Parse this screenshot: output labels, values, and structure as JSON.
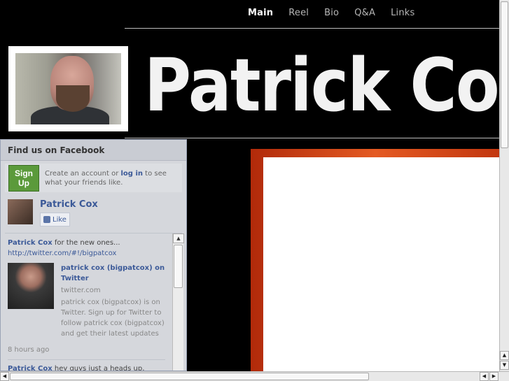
{
  "nav": {
    "items": [
      {
        "label": "Main"
      },
      {
        "label": "Reel"
      },
      {
        "label": "Bio"
      },
      {
        "label": "Q&A"
      },
      {
        "label": "Links"
      }
    ]
  },
  "banner": {
    "title": "Patrick Cox"
  },
  "facebook": {
    "header": "Find us on Facebook",
    "signup_button": "Sign Up",
    "signup_text_pre": "Create an account or ",
    "signup_link": "log in",
    "signup_text_post": " to see what your friends like.",
    "page_name": "Patrick Cox",
    "like_label": "Like",
    "posts": [
      {
        "author": "Patrick Cox",
        "text": " for the new ones...",
        "url": "http://twitter.com/#!/bigpatcox",
        "card_title": "patrick cox (bigpatcox) on Twitter",
        "card_domain": "twitter.com",
        "card_desc": "patrick cox (bigpatcox) is on Twitter. Sign up for Twitter to follow patrick cox (bigpatcox) and get their latest updates",
        "time": "8 hours ago"
      },
      {
        "author": "Patrick Cox",
        "text": " hey guys just a heads up, heading to"
      }
    ]
  },
  "icons": {
    "up_arrow": "▲",
    "down_arrow": "▼",
    "left_arrow": "◀",
    "right_arrow": "▶"
  },
  "colors": {
    "background": "#000000",
    "facebook_link": "#3b5998",
    "signup_green": "#5b9a3b",
    "panel_border": "#e04b1c"
  }
}
